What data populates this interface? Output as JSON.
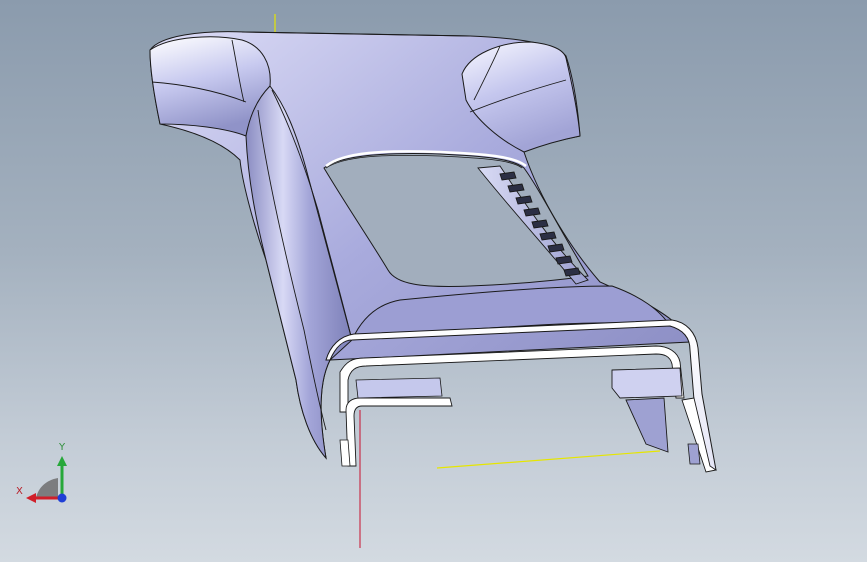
{
  "viewport": {
    "background_top": "#8b9bad",
    "background_bottom": "#d3dae1"
  },
  "model": {
    "shell_color": "#aeb0e2",
    "highlight_color": "#f4f4fc",
    "edge_color": "#1a1a1a"
  },
  "triad": {
    "x_label": "X",
    "y_label": "Y",
    "x_color": "#d01f2a",
    "y_color": "#27a83a",
    "z_color": "#1f3fd6"
  },
  "reference_lines": {
    "x_axis_color": "#c8102e",
    "plane_color": "#e6e600"
  }
}
